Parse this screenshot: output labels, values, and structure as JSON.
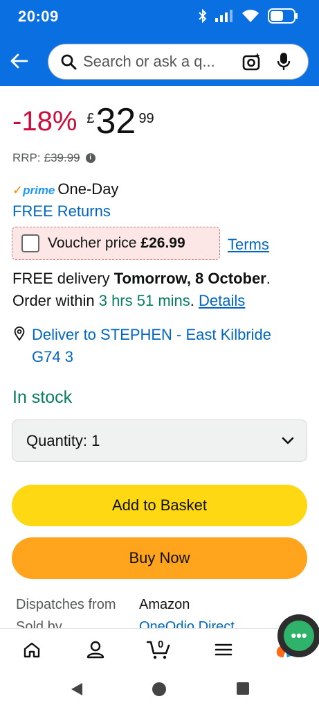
{
  "status_bar": {
    "time": "20:09",
    "icons": [
      "bluetooth-icon",
      "signal-icon",
      "wifi-icon",
      "battery-icon"
    ]
  },
  "header": {
    "search_placeholder": "Search or ask a q..."
  },
  "price": {
    "discount": "-18%",
    "currency": "£",
    "whole": "32",
    "fraction": "99"
  },
  "rrp": {
    "label": "RRP:",
    "value": "£39.99"
  },
  "prime": {
    "badge": "prime",
    "one_day": "One-Day",
    "free_returns": "FREE Returns"
  },
  "voucher": {
    "label": "Voucher price",
    "price": "£26.99",
    "terms": "Terms"
  },
  "delivery": {
    "line1_prefix": "FREE delivery",
    "line1_date": "Tomorrow, 8 October",
    "line1_suffix": ".",
    "line2_prefix": "Order within",
    "line2_time": "3 hrs 51 mins",
    "line2_sep": ".",
    "details": "Details"
  },
  "deliver_to": {
    "line1": "Deliver to STEPHEN - East Kilbride",
    "line2": "G74 3"
  },
  "stock": "In stock",
  "quantity": {
    "label": "Quantity: 1"
  },
  "buttons": {
    "add_to_basket": "Add to Basket",
    "buy_now": "Buy Now"
  },
  "seller": {
    "dispatches_label": "Dispatches from",
    "dispatches_value": "Amazon",
    "sold_label": "Sold by",
    "sold_value": "OneOdio Direct"
  },
  "chat": {
    "glyph": "•••"
  },
  "bottom_nav": {
    "basket_count": "0"
  },
  "colors": {
    "amazon_blue": "#0a6fe0",
    "discount_red": "#cc0c39",
    "stock_green": "#067d62",
    "link_blue": "#0066c0",
    "basket_yellow": "#ffd814",
    "buy_orange": "#ffa41c"
  }
}
